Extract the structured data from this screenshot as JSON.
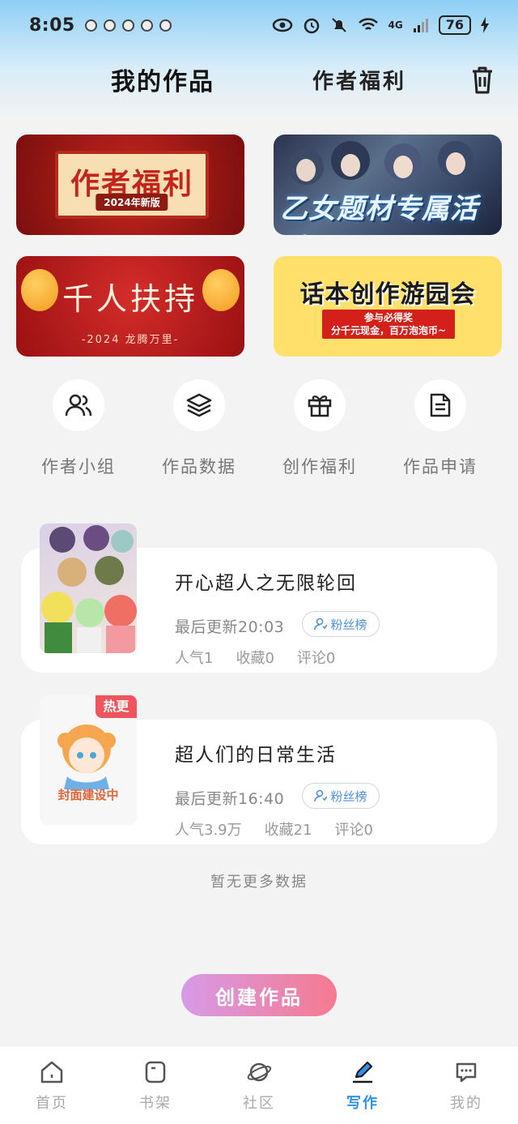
{
  "status": {
    "time": "8:05",
    "network": "4G",
    "battery": "76"
  },
  "header": {
    "my_works": "我的作品",
    "author_welfare": "作者福利"
  },
  "banners": [
    {
      "title": "作者福利",
      "subtitle": "2024年新版"
    },
    {
      "title": "乙女题材专属活动"
    },
    {
      "title": "千人扶持",
      "subtitle": "-2024 龙腾万里-"
    },
    {
      "title": "话本创作游园会",
      "subtitle_line1": "参与必得奖",
      "subtitle_line2": "分千元现金，百万泡泡币~"
    }
  ],
  "quick_actions": [
    {
      "label": "作者小组",
      "icon": "people-icon"
    },
    {
      "label": "作品数据",
      "icon": "layers-icon"
    },
    {
      "label": "创作福利",
      "icon": "gift-icon"
    },
    {
      "label": "作品申请",
      "icon": "document-icon"
    }
  ],
  "works": [
    {
      "title": "开心超人之无限轮回",
      "updated": "最后更新20:03",
      "fans_label": "粉丝榜",
      "popularity": "人气1",
      "favorites": "收藏0",
      "comments": "评论0"
    },
    {
      "title": "超人们的日常生活",
      "updated": "最后更新16:40",
      "fans_label": "粉丝榜",
      "popularity": "人气3.9万",
      "favorites": "收藏21",
      "comments": "评论0",
      "badge": "热更",
      "cover_text": "封面建设中"
    }
  ],
  "no_more": "暂无更多数据",
  "create_button": "创建作品",
  "nav": [
    {
      "label": "首页",
      "icon": "home-icon"
    },
    {
      "label": "书架",
      "icon": "bookshelf-icon"
    },
    {
      "label": "社区",
      "icon": "planet-icon"
    },
    {
      "label": "写作",
      "icon": "pen-icon",
      "active": true
    },
    {
      "label": "我的",
      "icon": "chat-icon"
    }
  ],
  "colors": {
    "accent": "#2f93ee",
    "hot_badge": "#f0545c",
    "create_start": "#d79ae8",
    "create_end": "#f57a8f"
  }
}
